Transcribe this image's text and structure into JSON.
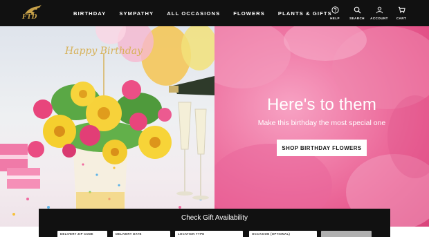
{
  "brand": {
    "logo_text": "FTD"
  },
  "nav": {
    "items": [
      {
        "label": "BIRTHDAY"
      },
      {
        "label": "SYMPATHY"
      },
      {
        "label": "ALL OCCASIONS"
      },
      {
        "label": "FLOWERS"
      },
      {
        "label": "PLANTS & GIFTS"
      }
    ]
  },
  "utilities": {
    "items": [
      {
        "label": "HELP",
        "icon": "help-icon"
      },
      {
        "label": "SEARCH",
        "icon": "search-icon"
      },
      {
        "label": "ACCOUNT",
        "icon": "account-icon"
      },
      {
        "label": "CART",
        "icon": "cart-icon"
      }
    ]
  },
  "hero": {
    "title": "Here's to them",
    "subtitle": "Make this birthday the most special one",
    "cta_label": "SHOP BIRTHDAY FLOWERS",
    "topper_text": "Happy Birthday"
  },
  "availability": {
    "title": "Check Gift Availability",
    "fields": [
      {
        "label": "DELIVERY ZIP CODE"
      },
      {
        "label": "DELIVERY DATE"
      },
      {
        "label": "LOCATION TYPE"
      },
      {
        "label": "OCCASION (OPTIONAL)"
      }
    ]
  },
  "colors": {
    "header_bg": "#111111",
    "logo_gold": "#c8a24a",
    "hero_pink": "#f07ea9",
    "panel_bg": "#111111"
  }
}
